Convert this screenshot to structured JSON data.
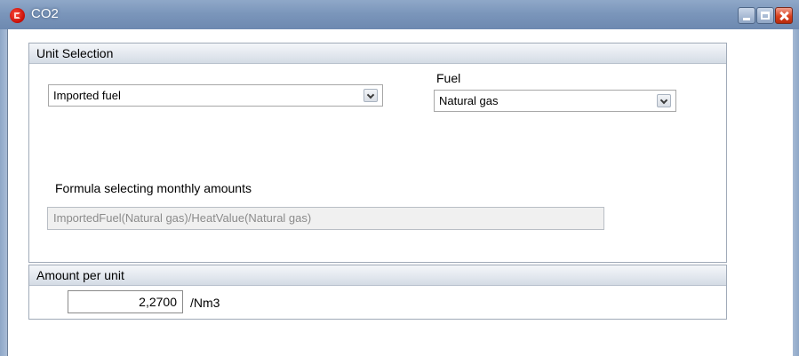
{
  "window": {
    "title": "CO2"
  },
  "unit_selection": {
    "header": "Unit Selection",
    "source_combo": {
      "value": "Imported fuel"
    },
    "fuel_label": "Fuel",
    "fuel_combo": {
      "value": "Natural gas"
    },
    "formula_label": "Formula selecting monthly amounts",
    "formula_value": "ImportedFuel(Natural gas)/HeatValue(Natural gas)"
  },
  "amount": {
    "header": "Amount per unit",
    "value": "2,2700",
    "unit": "/Nm3"
  },
  "colors": {
    "titlebar": "#7b96bb",
    "close_button": "#d9401d",
    "group_header": "#e3e8ef",
    "disabled_text": "#8b8b8b"
  },
  "icons": [
    "app-icon",
    "minimize-icon",
    "maximize-icon",
    "close-icon",
    "chevron-down-icon"
  ]
}
